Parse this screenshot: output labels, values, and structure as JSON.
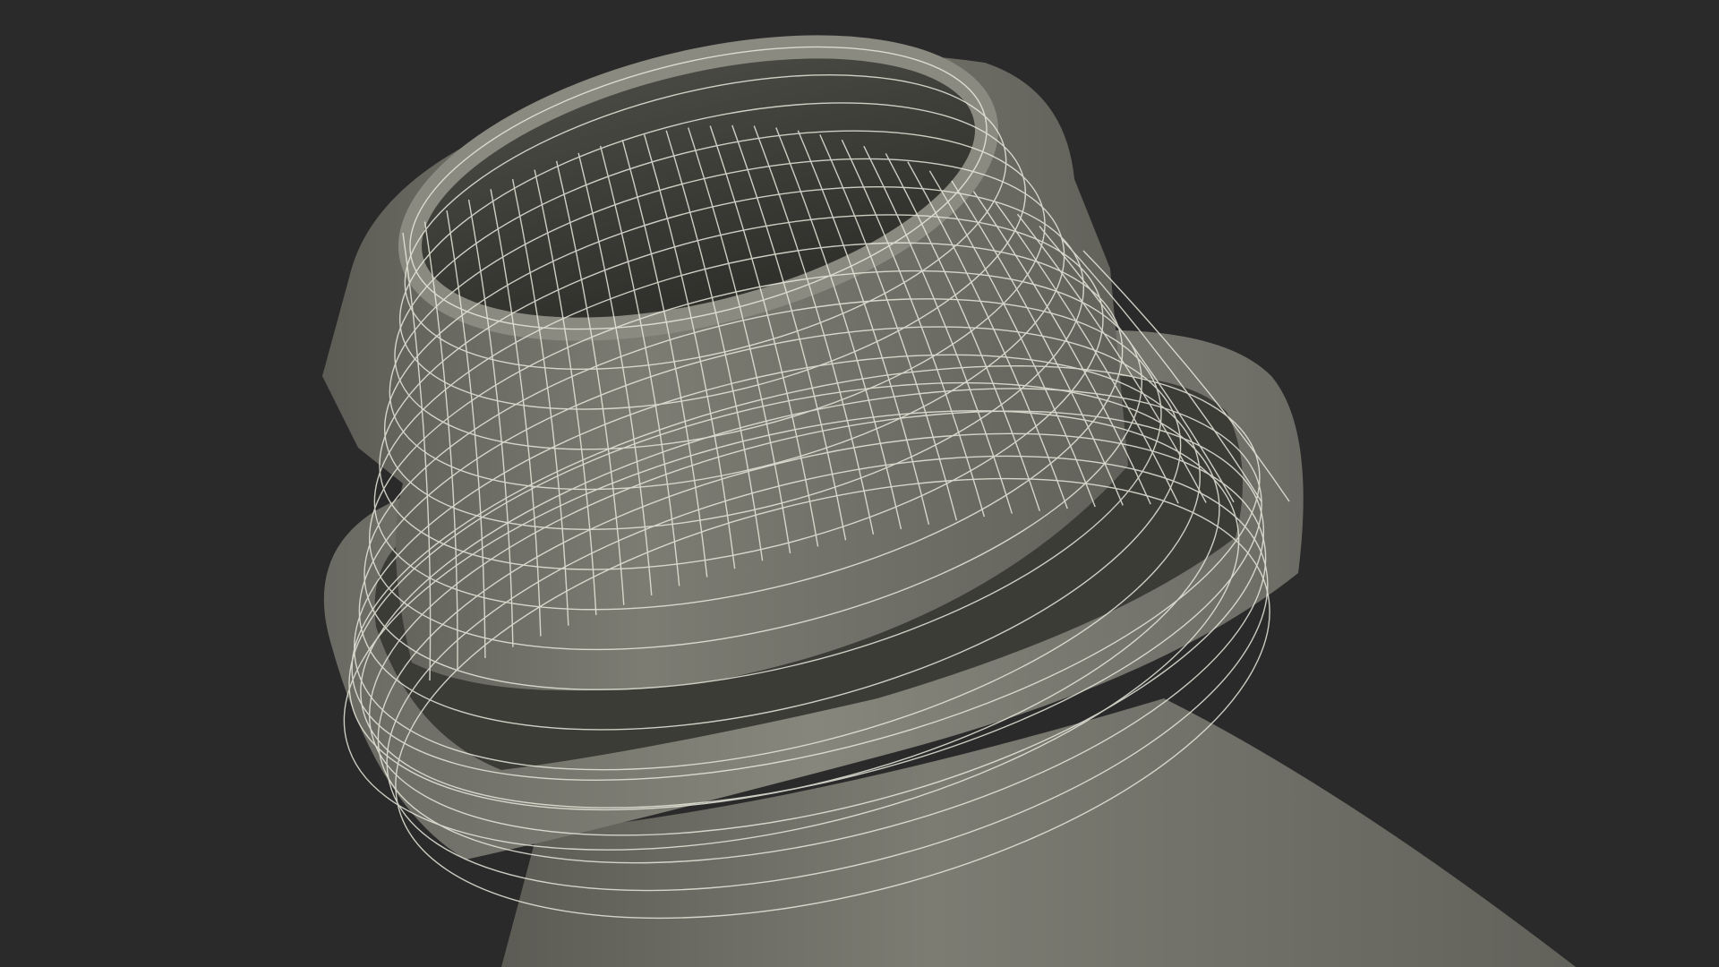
{
  "scene": {
    "subject": "wireframe-bottle-neck",
    "colors": {
      "background": "#2a2a2a",
      "surface": "#6e6e66",
      "surface_light": "#8a8a80",
      "surface_dark": "#4e4e48",
      "interior": "#3a3a34",
      "wire": "#e8e8dc"
    }
  }
}
